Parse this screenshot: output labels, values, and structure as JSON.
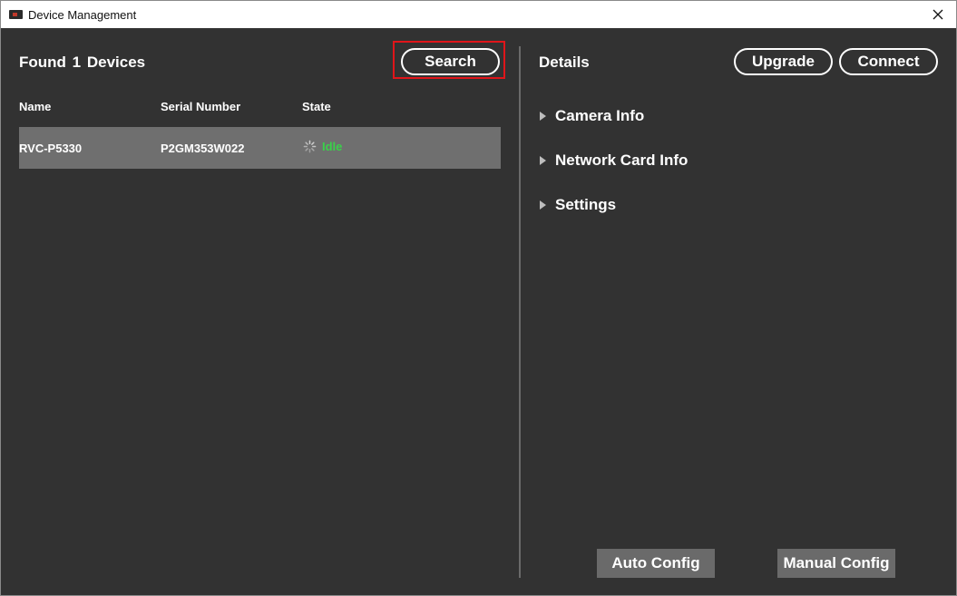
{
  "window": {
    "title": "Device Management"
  },
  "devices_panel": {
    "found_prefix": "Found",
    "found_count": "1",
    "found_suffix": "Devices",
    "search_label": "Search",
    "columns": [
      "Name",
      "Serial Number",
      "State"
    ],
    "rows": [
      {
        "name": "RVC-P5330",
        "serial": "P2GM353W022",
        "state": "Idle"
      }
    ]
  },
  "details_panel": {
    "title": "Details",
    "upgrade_label": "Upgrade",
    "connect_label": "Connect",
    "sections": [
      "Camera Info",
      "Network Card Info",
      "Settings"
    ],
    "auto_config_label": "Auto Config",
    "manual_config_label": "Manual Config"
  },
  "colors": {
    "background": "#323232",
    "selected_row": "#6f6f6f",
    "idle_state": "#3ad14a",
    "highlight": "#e0151a"
  },
  "icons": {
    "app": "camera-app-icon",
    "close": "close-icon",
    "state": "loading-spinner-icon",
    "expand": "triangle-right-icon"
  }
}
